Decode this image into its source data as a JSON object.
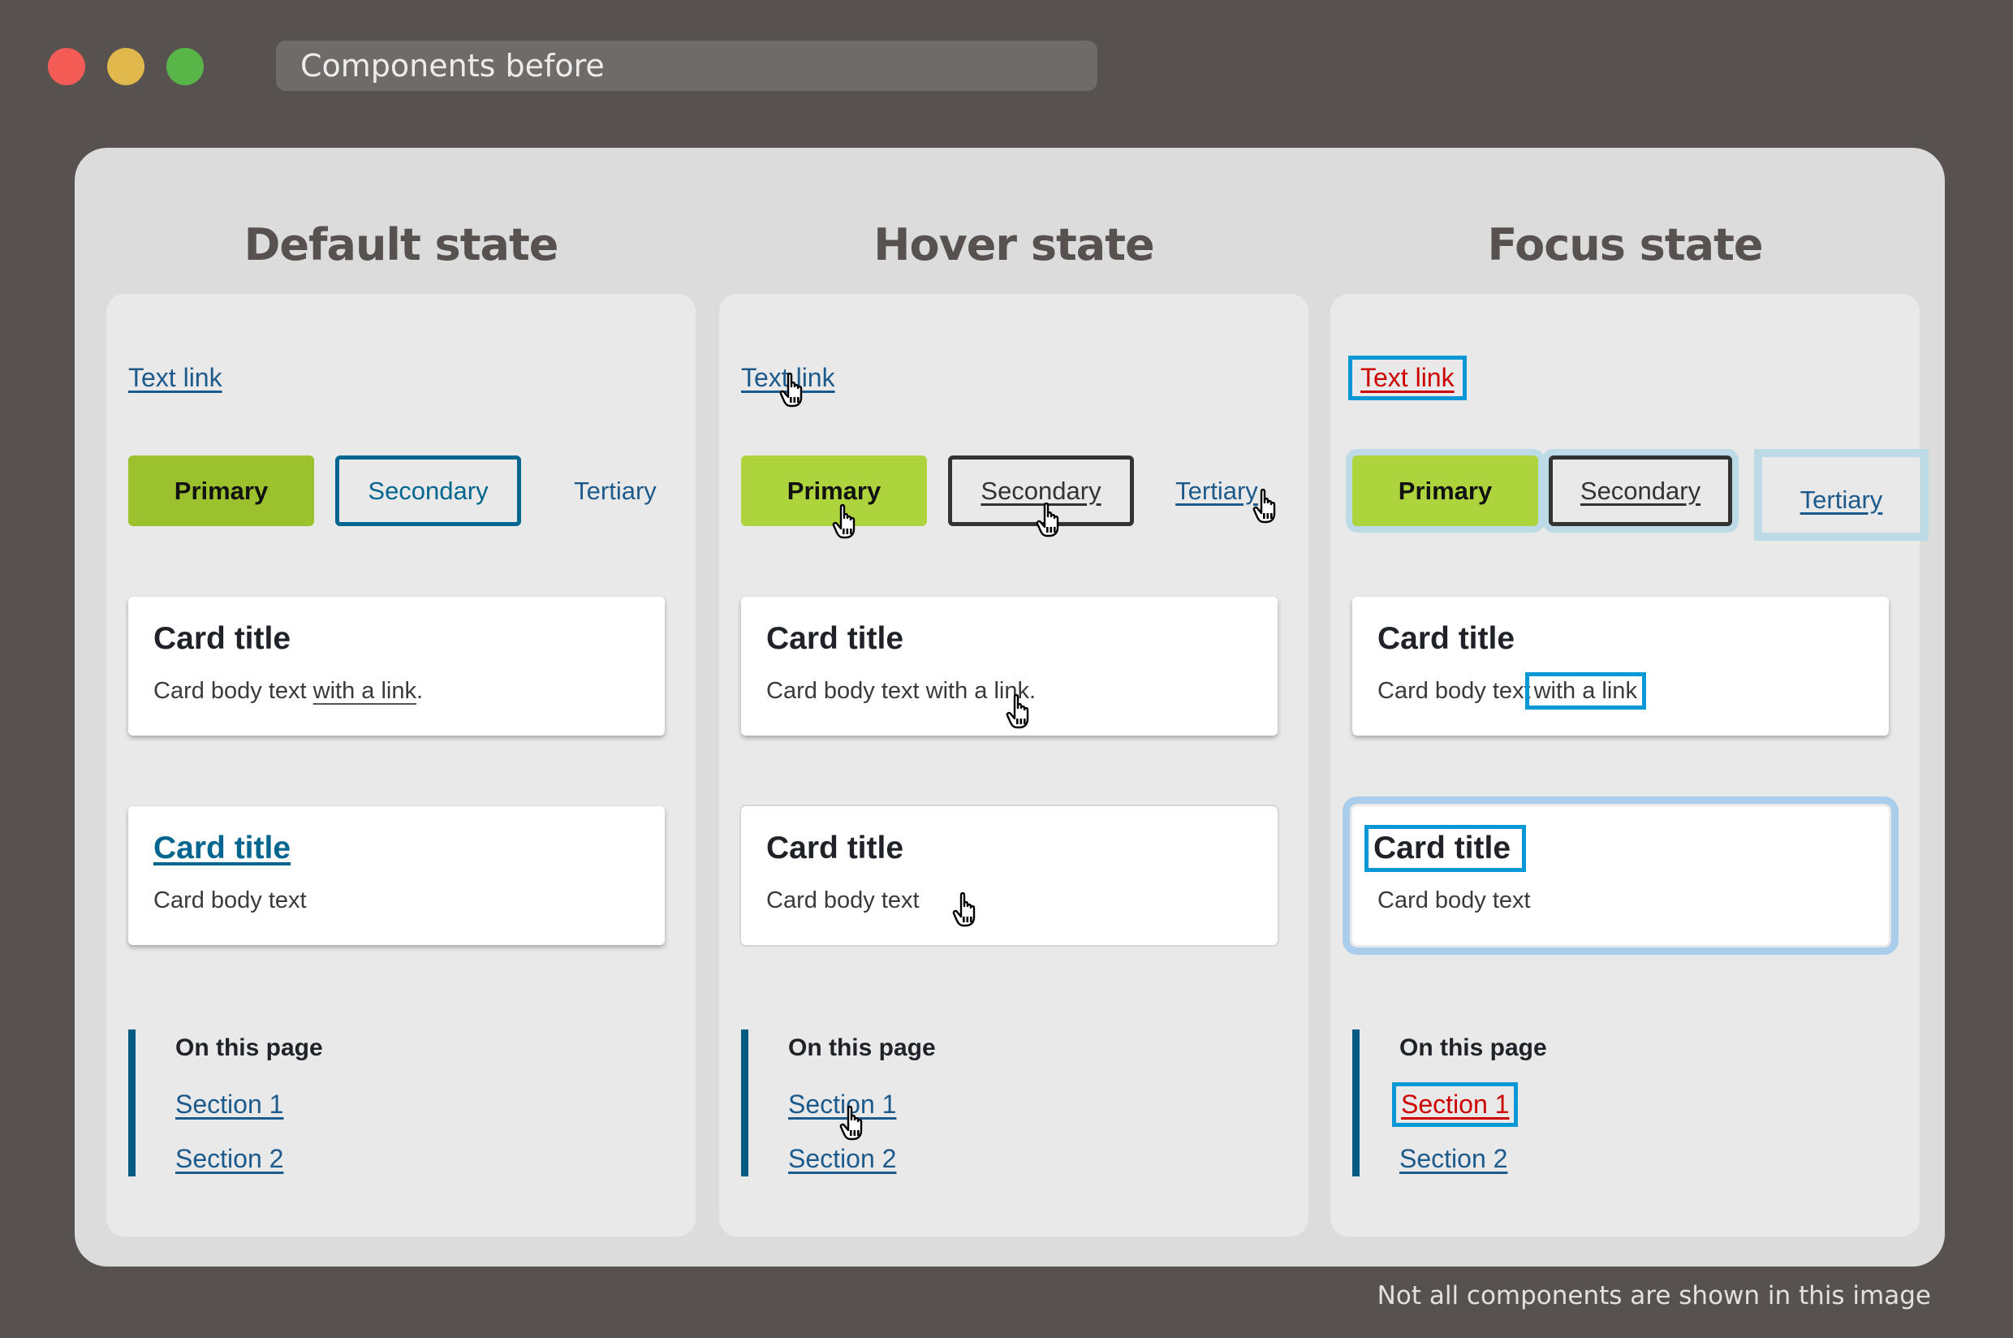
{
  "window": {
    "title": "Components before",
    "controls": [
      "close",
      "minimize",
      "maximize"
    ]
  },
  "columns": [
    {
      "heading": "Default state",
      "text_link": "Text link",
      "buttons": {
        "primary": "Primary",
        "secondary": "Secondary",
        "tertiary": "Tertiary"
      },
      "card1": {
        "title": "Card title",
        "body_prefix": "Card body text ",
        "body_link": "with a link",
        "body_suffix": "."
      },
      "card2": {
        "title": "Card title",
        "body": "Card body text"
      },
      "toc": {
        "heading": "On this page",
        "links": [
          "Section 1",
          "Section 2"
        ]
      }
    },
    {
      "heading": "Hover state",
      "text_link": "Text link",
      "buttons": {
        "primary": "Primary",
        "secondary": "Secondary",
        "tertiary": "Tertiary"
      },
      "card1": {
        "title": "Card title",
        "body_prefix": "Card body text ",
        "body_link": "with a link",
        "body_suffix": "."
      },
      "card2": {
        "title": "Card title",
        "body": "Card body text"
      },
      "toc": {
        "heading": "On this page",
        "links": [
          "Section 1",
          "Section 2"
        ]
      }
    },
    {
      "heading": "Focus state",
      "text_link": "Text link",
      "buttons": {
        "primary": "Primary",
        "secondary": "Secondary",
        "tertiary": "Tertiary"
      },
      "card1": {
        "title": "Card title",
        "body_prefix": "Card body text",
        "body_link": "with a link",
        "body_suffix": ""
      },
      "card2": {
        "title": "Card title",
        "body": "Card body text"
      },
      "toc": {
        "heading": "On this page",
        "links": [
          "Section 1",
          "Section 2"
        ]
      }
    }
  ],
  "footnote": "Not all components are shown in this image",
  "colors": {
    "background": "#57524f",
    "panel": "#dcdcdc",
    "column": "#e9e9e9",
    "primary_default": "#9bc12d",
    "primary_hover": "#add43d",
    "link": "#1d5a8c",
    "secondary_border": "#006690",
    "focus_ring": "#0a97d6",
    "focus_halo": "#bcdbe6",
    "focus_link_text": "#cc0000",
    "toc_bar": "#005a82"
  }
}
